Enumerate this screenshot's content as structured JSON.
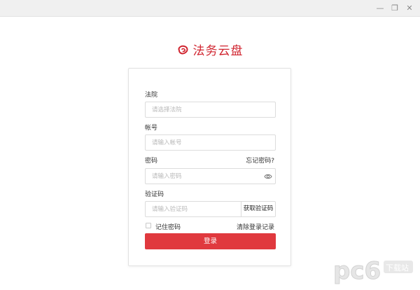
{
  "window": {
    "min_glyph": "—",
    "max_glyph": "❐",
    "close_glyph": "✕"
  },
  "brand": {
    "title": "法务云盘",
    "color": "#d0242f"
  },
  "form": {
    "court_label": "法院",
    "court_placeholder": "请选择法院",
    "account_label": "帐号",
    "account_placeholder": "请输入帐号",
    "password_label": "密码",
    "forgot_password": "忘记密码?",
    "password_placeholder": "请输入密码",
    "captcha_label": "验证码",
    "captcha_placeholder": "请输入验证码",
    "get_captcha": "获取验证码",
    "remember_password": "记住密码",
    "clear_records": "清除登录记录",
    "login_button": "登录",
    "accent_color": "#e0393e"
  },
  "watermark": {
    "logo_text": "pc6",
    "badge_text": "下载站"
  }
}
